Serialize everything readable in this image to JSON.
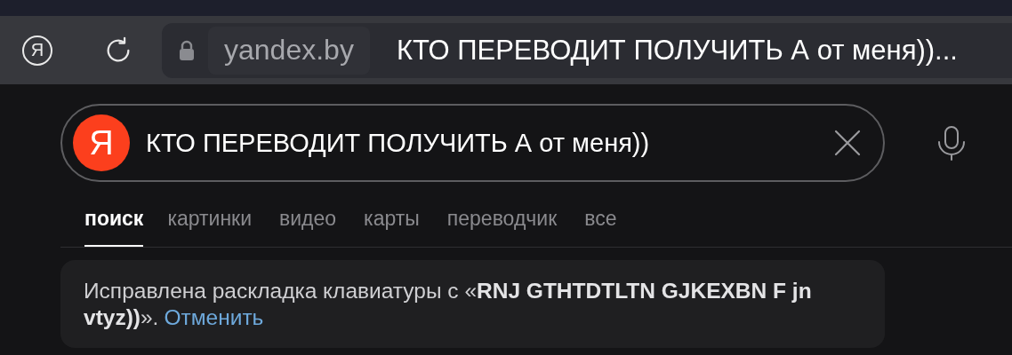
{
  "browser": {
    "logo_letter": "Я",
    "domain": "yandex.by",
    "page_title": "КТО ПЕРЕВОДИТ ПОЛУЧИТЬ А от меня))..."
  },
  "search": {
    "logo_letter": "Я",
    "value": "КТО ПЕРЕВОДИТ ПОЛУЧИТЬ А от меня))"
  },
  "tabs": [
    {
      "label": "поиск",
      "selected": true
    },
    {
      "label": "картинки",
      "selected": false
    },
    {
      "label": "видео",
      "selected": false
    },
    {
      "label": "карты",
      "selected": false
    },
    {
      "label": "переводчик",
      "selected": false
    },
    {
      "label": "все",
      "selected": false
    }
  ],
  "notice": {
    "text": "Исправлена раскладка клавиатуры с «**RNJ GTHTDTLTN GJKEXBN F jn vtyz))**».",
    "link": "Отменить"
  }
}
